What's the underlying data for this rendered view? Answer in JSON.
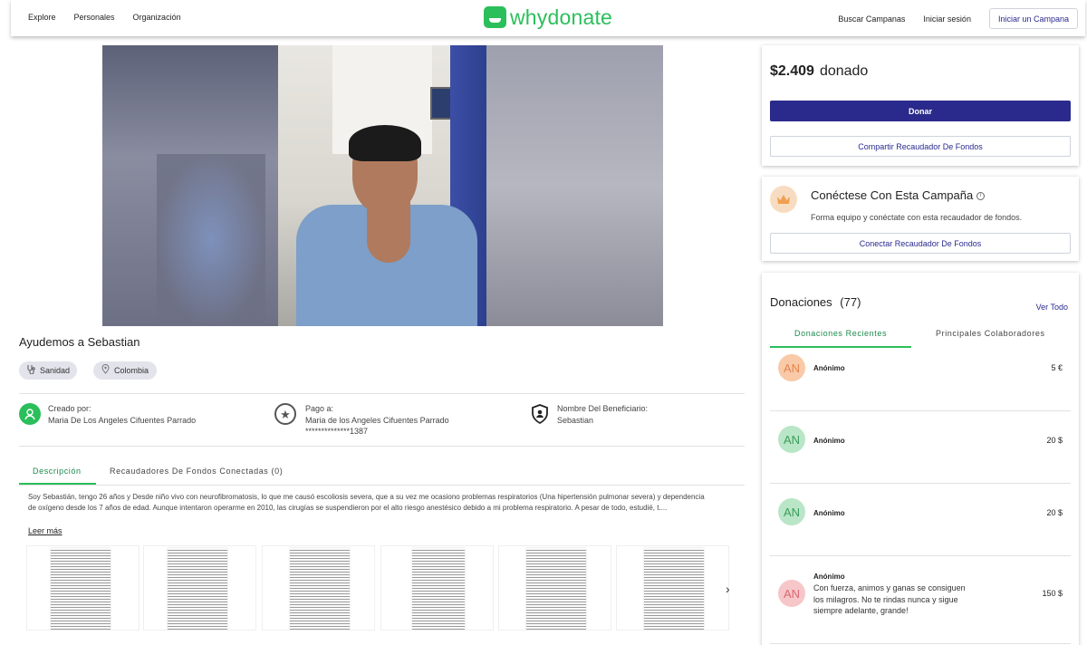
{
  "nav": {
    "left": [
      "Explore",
      "Personales",
      "Organización"
    ],
    "logo_text": "whydonate",
    "search_campaigns": "Buscar Campanas",
    "login": "Iniciar sesión",
    "start_campaign": "Iniciar un Campana"
  },
  "campaign": {
    "title": "Ayudemos a Sebastian",
    "tags": {
      "category": "Sanidad",
      "location": "Colombia"
    },
    "created_by_label": "Creado por:",
    "created_by": "Maria De Los Angeles Cifuentes Parrado",
    "pay_to_label": "Pago a:",
    "pay_to": "Maria de los Angeles Cifuentes Parrado",
    "pay_account": "**************1387",
    "beneficiary_label": "Nombre Del Beneficiario:",
    "beneficiary": "Sebastian",
    "tabs": {
      "description": "Descripción",
      "connected": "Recaudadores De Fondos Conectadas (0)"
    },
    "description_line1": "Soy Sebastián, tengo 26 años y Desde niño vivo con neurofibromatosis, lo que me causó escoliosis severa, que a su vez me ocasiono problemas respiratorios (Una hipertensión pulmonar severa) y dependencia",
    "description_line2": "de oxígeno desde los 7 años de edad. Aunque intentaron operarme en 2010, las cirugías se suspendieron por el alto riesgo anestésico debido a mi problema respiratorio. A pesar de todo, estudié, t....",
    "read_more": "Leer más",
    "carousel_prev": "‹",
    "carousel_next": "›"
  },
  "donate_card": {
    "amount": "$2.409",
    "amount_suffix": "donado",
    "donate_button": "Donar",
    "share_button": "Compartir Recaudador De Fondos"
  },
  "connect_card": {
    "title": "Conéctese Con Esta Campaña",
    "subtitle": "Forma equipo y conéctate con esta recaudador de fondos.",
    "button": "Conectar Recaudador De Fondos"
  },
  "donations": {
    "title": "Donaciones",
    "count": "(77)",
    "view_all": "Ver Todo",
    "tab_recent": "Donaciones Recientes",
    "tab_top": "Principales Colaboradores",
    "items": [
      {
        "initials": "AN",
        "name": "Anónimo",
        "amount": "5 €",
        "message": ""
      },
      {
        "initials": "AN",
        "name": "Anónimo",
        "amount": "20 $",
        "message": ""
      },
      {
        "initials": "AN",
        "name": "Anónimo",
        "amount": "20 $",
        "message": ""
      },
      {
        "initials": "AN",
        "name": "Anónimo",
        "amount": "150 $",
        "message": "Con fuerza, animos y ganas se consiguen los milagros. No te rindas nunca y sigue siempre adelante, grande!"
      }
    ]
  },
  "colors": {
    "brand_green": "#2bbf5b",
    "primary_blue": "#2a2a8c",
    "avatar_orange": "#f9c9a8",
    "avatar_green": "#b9e6c6",
    "avatar_pink": "#f7c6c9"
  }
}
